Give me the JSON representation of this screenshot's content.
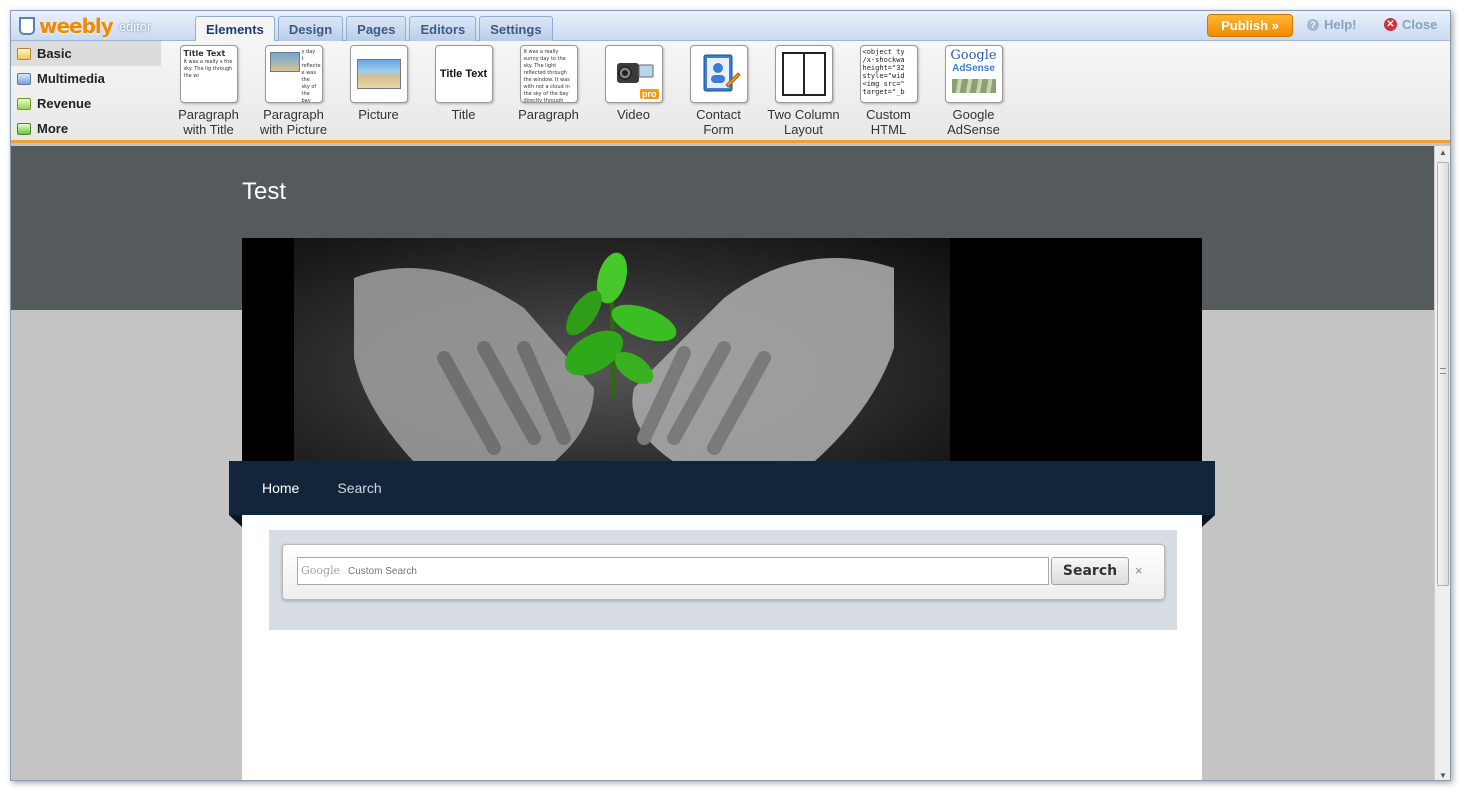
{
  "app": {
    "brand": "weebly",
    "brand_suffix": "editor"
  },
  "tabs": [
    {
      "label": "Elements"
    },
    {
      "label": "Design"
    },
    {
      "label": "Pages"
    },
    {
      "label": "Editors"
    },
    {
      "label": "Settings"
    }
  ],
  "toolbar": {
    "publish_label": "Publish »",
    "help_label": "Help!",
    "close_label": "Close"
  },
  "categories": [
    {
      "label": "Basic"
    },
    {
      "label": "Multimedia"
    },
    {
      "label": "Revenue"
    },
    {
      "label": "More"
    }
  ],
  "elements": [
    {
      "label1": "Paragraph",
      "label2": "with Title",
      "thumb_title": "Title Text",
      "thumb_text": "It was a really s the sky. The lig through the wi"
    },
    {
      "label1": "Paragraph",
      "label2": "with Picture",
      "thumb_text": "y day t reflecte e was the sky of the bay directly through reflected off of the bay"
    },
    {
      "label1": "Picture",
      "label2": ""
    },
    {
      "label1": "Title",
      "label2": "",
      "thumb_title": "Title Text"
    },
    {
      "label1": "Paragraph",
      "label2": "",
      "thumb_text": "It was a really sunny day to the sky. The light reflected through the window. It was with not a cloud in the sky of the bay directly through reflected off of the bay dire"
    },
    {
      "label1": "Video",
      "label2": "",
      "badge": "pro"
    },
    {
      "label1": "Contact",
      "label2": "Form"
    },
    {
      "label1": "Two Column",
      "label2": "Layout"
    },
    {
      "label1": "Custom",
      "label2": "HTML",
      "code": "<object ty\n/x-shockwa\nheight=\"32\nstyle=\"wid\n<img src=\"\ntarget=\"_b"
    },
    {
      "label1": "Google",
      "label2": "AdSense",
      "thumb_title": "Google",
      "thumb_sub": "AdSense"
    }
  ],
  "site": {
    "title": "Test",
    "nav": [
      {
        "label": "Home"
      },
      {
        "label": "Search"
      }
    ],
    "search": {
      "placeholder": "Custom Search",
      "google_mark": "Google",
      "button_label": "Search",
      "clear": "×"
    }
  },
  "colors": {
    "accent_orange": "#f28a00",
    "header_band": "#555a5c",
    "nav_bar": "#13253a"
  }
}
